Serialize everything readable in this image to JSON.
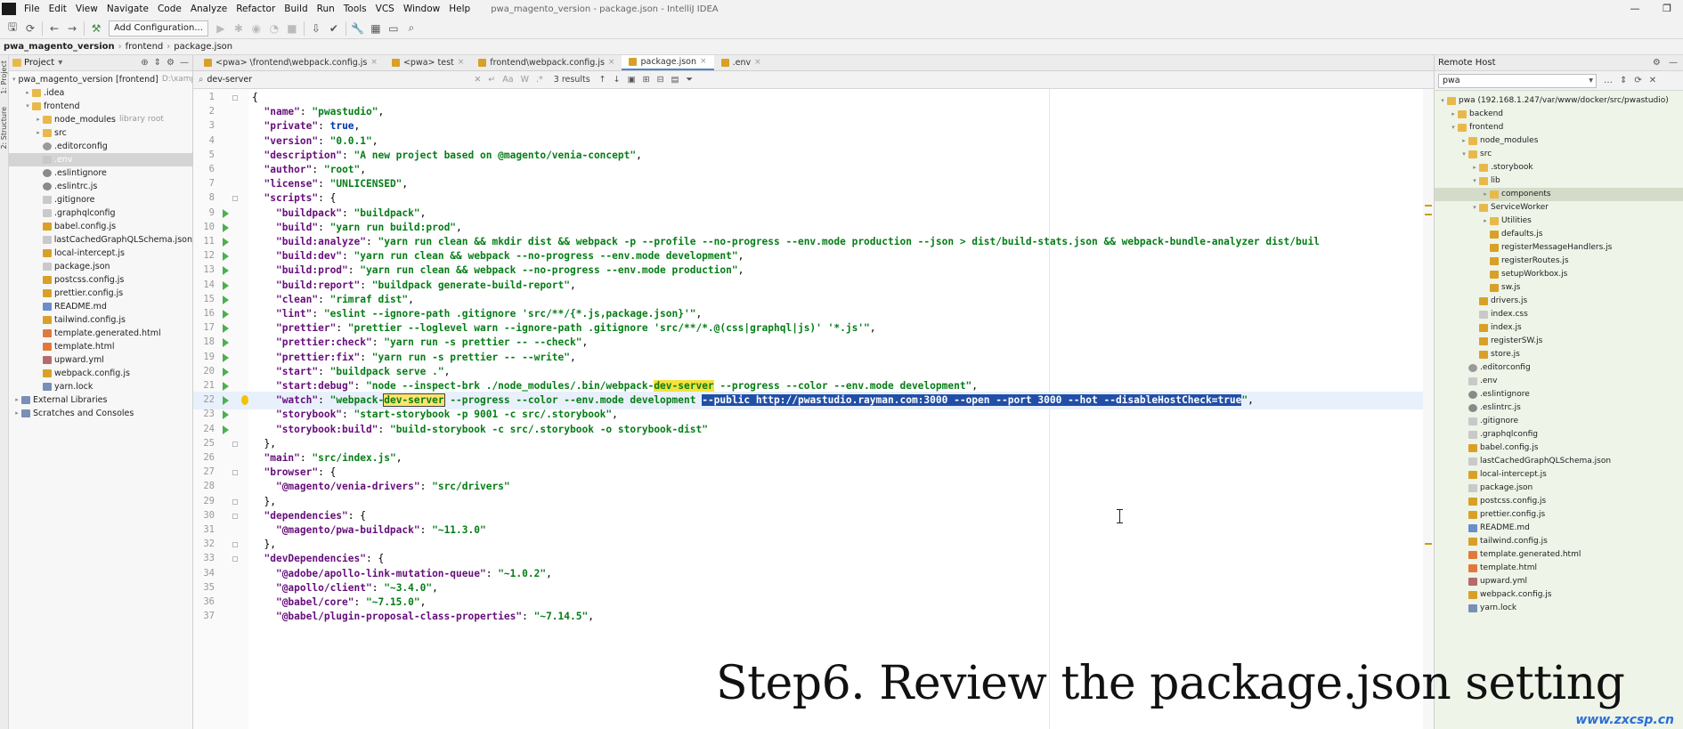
{
  "window": {
    "title": "pwa_magento_version - package.json - IntelliJ IDEA",
    "menu": [
      "File",
      "Edit",
      "View",
      "Navigate",
      "Code",
      "Analyze",
      "Refactor",
      "Build",
      "Run",
      "Tools",
      "VCS",
      "Window",
      "Help"
    ],
    "controls": [
      "—",
      "❐"
    ]
  },
  "toolbar": {
    "add_config": "Add Configuration..."
  },
  "breadcrumb": [
    "pwa_magento_version",
    "frontend",
    "package.json"
  ],
  "project": {
    "title": "Project",
    "strip_label": "1: Project",
    "strip_label2": "2: Structure",
    "tree": [
      {
        "label": "pwa_magento_version [frontend]",
        "extra": "D:\\xampp",
        "indent": 0,
        "arrow": "▾",
        "icon": "fold"
      },
      {
        "label": ".idea",
        "indent": 1,
        "arrow": "▸",
        "icon": "fold"
      },
      {
        "label": "frontend",
        "indent": 1,
        "arrow": "▾",
        "icon": "fold"
      },
      {
        "label": "node_modules",
        "extra": "library root",
        "indent": 2,
        "arrow": "▸",
        "icon": "fold"
      },
      {
        "label": "src",
        "indent": 2,
        "arrow": "▸",
        "icon": "fold"
      },
      {
        "label": ".editorconfig",
        "indent": 2,
        "arrow": "",
        "icon": "gear"
      },
      {
        "label": ".env",
        "indent": 2,
        "arrow": "",
        "icon": "file",
        "selected": true
      },
      {
        "label": ".eslintignore",
        "indent": 2,
        "arrow": "",
        "icon": "cfg"
      },
      {
        "label": ".eslintrc.js",
        "indent": 2,
        "arrow": "",
        "icon": "cfg"
      },
      {
        "label": ".gitignore",
        "indent": 2,
        "arrow": "",
        "icon": "file"
      },
      {
        "label": ".graphqlconfig",
        "indent": 2,
        "arrow": "",
        "icon": "file"
      },
      {
        "label": "babel.config.js",
        "indent": 2,
        "arrow": "",
        "icon": "js"
      },
      {
        "label": "lastCachedGraphQLSchema.json",
        "indent": 2,
        "arrow": "",
        "icon": "file"
      },
      {
        "label": "local-intercept.js",
        "indent": 2,
        "arrow": "",
        "icon": "js"
      },
      {
        "label": "package.json",
        "indent": 2,
        "arrow": "",
        "icon": "file"
      },
      {
        "label": "postcss.config.js",
        "indent": 2,
        "arrow": "",
        "icon": "js"
      },
      {
        "label": "prettier.config.js",
        "indent": 2,
        "arrow": "",
        "icon": "js"
      },
      {
        "label": "README.md",
        "indent": 2,
        "arrow": "",
        "icon": "md"
      },
      {
        "label": "tailwind.config.js",
        "indent": 2,
        "arrow": "",
        "icon": "js"
      },
      {
        "label": "template.generated.html",
        "indent": 2,
        "arrow": "",
        "icon": "html"
      },
      {
        "label": "template.html",
        "indent": 2,
        "arrow": "",
        "icon": "html"
      },
      {
        "label": "upward.yml",
        "indent": 2,
        "arrow": "",
        "icon": "yml"
      },
      {
        "label": "webpack.config.js",
        "indent": 2,
        "arrow": "",
        "icon": "js"
      },
      {
        "label": "yarn.lock",
        "indent": 2,
        "arrow": "",
        "icon": "lib"
      },
      {
        "label": "External Libraries",
        "indent": 0,
        "arrow": "▸",
        "icon": "lib"
      },
      {
        "label": "Scratches and Consoles",
        "indent": 0,
        "arrow": "▸",
        "icon": "lib"
      }
    ]
  },
  "tabs": [
    {
      "label": "<pwa> \\frontend\\webpack.config.js",
      "active": false
    },
    {
      "label": "<pwa> test",
      "active": false
    },
    {
      "label": "frontend\\webpack.config.js",
      "active": false
    },
    {
      "label": "package.json",
      "active": true
    },
    {
      "label": ".env",
      "active": false
    }
  ],
  "search": {
    "query": "dev-server",
    "results": "3 results"
  },
  "editor": {
    "lines": [
      {
        "n": "1",
        "html": "{",
        "fold": true
      },
      {
        "n": "2",
        "html": "  <span class='k'>\"name\"</span>: <span class='s'>\"pwastudio\"</span>,"
      },
      {
        "n": "3",
        "html": "  <span class='k'>\"private\"</span>: <span class='v'>true</span>,"
      },
      {
        "n": "4",
        "html": "  <span class='k'>\"version\"</span>: <span class='s'>\"0.0.1\"</span>,"
      },
      {
        "n": "5",
        "html": "  <span class='k'>\"description\"</span>: <span class='s'>\"A new project based on @magento/venia-concept\"</span>,"
      },
      {
        "n": "6",
        "html": "  <span class='k'>\"author\"</span>: <span class='s'>\"root\"</span>,"
      },
      {
        "n": "7",
        "html": "  <span class='k'>\"license\"</span>: <span class='s'>\"UNLICENSED\"</span>,"
      },
      {
        "n": "8",
        "html": "  <span class='k'>\"scripts\"</span>: {",
        "fold": true
      },
      {
        "n": "9",
        "html": "    <span class='k'>\"buildpack\"</span>: <span class='s'>\"buildpack\"</span>,",
        "run": true
      },
      {
        "n": "10",
        "html": "    <span class='k'>\"build\"</span>: <span class='s'>\"yarn run build:prod\"</span>,",
        "run": true
      },
      {
        "n": "11",
        "html": "    <span class='k'>\"build:analyze\"</span>: <span class='s'>\"yarn run clean &amp;&amp; mkdir dist &amp;&amp; webpack -p --profile --no-progress --env.mode production --json &gt; dist/build-stats.json &amp;&amp; webpack-bundle-analyzer dist/buil</span>",
        "run": true
      },
      {
        "n": "12",
        "html": "    <span class='k'>\"build:dev\"</span>: <span class='s'>\"yarn run clean &amp;&amp; webpack --no-progress --env.mode development\"</span>,",
        "run": true
      },
      {
        "n": "13",
        "html": "    <span class='k'>\"build:prod\"</span>: <span class='s'>\"yarn run clean &amp;&amp; webpack --no-progress --env.mode production\"</span>,",
        "run": true
      },
      {
        "n": "14",
        "html": "    <span class='k'>\"build:report\"</span>: <span class='s'>\"buildpack generate-build-report\"</span>,",
        "run": true
      },
      {
        "n": "15",
        "html": "    <span class='k'>\"clean\"</span>: <span class='s'>\"rimraf dist\"</span>,",
        "run": true
      },
      {
        "n": "16",
        "html": "    <span class='k'>\"lint\"</span>: <span class='s'>\"eslint --ignore-path .gitignore 'src/**/{*.js,package.json}'\"</span>,",
        "run": true
      },
      {
        "n": "17",
        "html": "    <span class='k'>\"prettier\"</span>: <span class='s'>\"prettier --loglevel warn --ignore-path .gitignore 'src/**/*.@(css|graphql|js)' '*.js'\"</span>,",
        "run": true
      },
      {
        "n": "18",
        "html": "    <span class='k'>\"prettier:check\"</span>: <span class='s'>\"yarn run -s prettier -- --check\"</span>,",
        "run": true
      },
      {
        "n": "19",
        "html": "    <span class='k'>\"prettier:fix\"</span>: <span class='s'>\"yarn run -s prettier -- --write\"</span>,",
        "run": true
      },
      {
        "n": "20",
        "html": "    <span class='k'>\"start\"</span>: <span class='s'>\"buildpack serve .\"</span>,",
        "run": true
      },
      {
        "n": "21",
        "html": "    <span class='k'>\"start:debug\"</span>: <span class='s'>\"node --inspect-brk ./node_modules/.bin/webpack-<span class='hl'>dev-server</span> --progress --color --env.mode development\"</span>,",
        "run": true
      },
      {
        "n": "22",
        "html": "    <span class='k'>\"watch\"</span>: <span class='s'>\"webpack-<span class='hlb'>dev-server</span> --progress --color --env.mode development <span class='sel'>--public http://pwastudio.rayman.com:3000 --open --port 3000 --hot --disableHostCheck=true</span>\"</span>,",
        "run": true,
        "bulb": true,
        "current": true
      },
      {
        "n": "23",
        "html": "    <span class='k'>\"storybook\"</span>: <span class='s'>\"start-storybook -p 9001 -c src/.storybook\"</span>,",
        "run": true
      },
      {
        "n": "24",
        "html": "    <span class='k'>\"storybook:build\"</span>: <span class='s'>\"build-storybook -c src/.storybook -o storybook-dist\"</span>",
        "run": true
      },
      {
        "n": "25",
        "html": "  },",
        "fold": true
      },
      {
        "n": "26",
        "html": "  <span class='k'>\"main\"</span>: <span class='s'>\"src/index.js\"</span>,"
      },
      {
        "n": "27",
        "html": "  <span class='k'>\"browser\"</span>: {",
        "fold": true
      },
      {
        "n": "28",
        "html": "    <span class='k'>\"@magento/venia-drivers\"</span>: <span class='s'>\"src/drivers\"</span>"
      },
      {
        "n": "29",
        "html": "  },",
        "fold": true
      },
      {
        "n": "30",
        "html": "  <span class='k'>\"dependencies\"</span>: {",
        "fold": true
      },
      {
        "n": "31",
        "html": "    <span class='k'>\"@magento/pwa-buildpack\"</span>: <span class='s'>\"~11.3.0\"</span>"
      },
      {
        "n": "32",
        "html": "  },",
        "fold": true
      },
      {
        "n": "33",
        "html": "  <span class='k'>\"devDependencies\"</span>: {",
        "fold": true
      },
      {
        "n": "34",
        "html": "    <span class='k'>\"@adobe/apollo-link-mutation-queue\"</span>: <span class='s'>\"~1.0.2\"</span>,"
      },
      {
        "n": "35",
        "html": "    <span class='k'>\"@apollo/client\"</span>: <span class='s'>\"~3.4.0\"</span>,"
      },
      {
        "n": "36",
        "html": "    <span class='k'>\"@babel/core\"</span>: <span class='s'>\"~7.15.0\"</span>,"
      },
      {
        "n": "37",
        "html": "    <span class='k'>\"@babel/plugin-proposal-class-properties\"</span>: <span class='s'>\"~7.14.5\"</span>,"
      }
    ]
  },
  "remote": {
    "title": "Remote Host",
    "server": "pwa",
    "tree": [
      {
        "label": "pwa (192.168.1.247/var/www/docker/src/pwastudio)",
        "indent": 0,
        "arrow": "▾",
        "icon": "fold"
      },
      {
        "label": "backend",
        "indent": 1,
        "arrow": "▸",
        "icon": "fold"
      },
      {
        "label": "frontend",
        "indent": 1,
        "arrow": "▾",
        "icon": "fold"
      },
      {
        "label": "node_modules",
        "indent": 2,
        "arrow": "▸",
        "icon": "fold"
      },
      {
        "label": "src",
        "indent": 2,
        "arrow": "▾",
        "icon": "fold"
      },
      {
        "label": ".storybook",
        "indent": 3,
        "arrow": "▸",
        "icon": "fold"
      },
      {
        "label": "lib",
        "indent": 3,
        "arrow": "▾",
        "icon": "fold"
      },
      {
        "label": "components",
        "indent": 4,
        "arrow": "▸",
        "icon": "fold",
        "hi": true
      },
      {
        "label": "ServiceWorker",
        "indent": 3,
        "arrow": "▾",
        "icon": "fold"
      },
      {
        "label": "Utilities",
        "indent": 4,
        "arrow": "▸",
        "icon": "fold"
      },
      {
        "label": "defaults.js",
        "indent": 4,
        "arrow": "",
        "icon": "js"
      },
      {
        "label": "registerMessageHandlers.js",
        "indent": 4,
        "arrow": "",
        "icon": "js"
      },
      {
        "label": "registerRoutes.js",
        "indent": 4,
        "arrow": "",
        "icon": "js"
      },
      {
        "label": "setupWorkbox.js",
        "indent": 4,
        "arrow": "",
        "icon": "js"
      },
      {
        "label": "sw.js",
        "indent": 4,
        "arrow": "",
        "icon": "js"
      },
      {
        "label": "drivers.js",
        "indent": 3,
        "arrow": "",
        "icon": "js"
      },
      {
        "label": "index.css",
        "indent": 3,
        "arrow": "",
        "icon": "file"
      },
      {
        "label": "index.js",
        "indent": 3,
        "arrow": "",
        "icon": "js"
      },
      {
        "label": "registerSW.js",
        "indent": 3,
        "arrow": "",
        "icon": "js"
      },
      {
        "label": "store.js",
        "indent": 3,
        "arrow": "",
        "icon": "js"
      },
      {
        "label": ".editorconfig",
        "indent": 2,
        "arrow": "",
        "icon": "gear"
      },
      {
        "label": ".env",
        "indent": 2,
        "arrow": "",
        "icon": "file"
      },
      {
        "label": ".eslintignore",
        "indent": 2,
        "arrow": "",
        "icon": "cfg"
      },
      {
        "label": ".eslintrc.js",
        "indent": 2,
        "arrow": "",
        "icon": "cfg"
      },
      {
        "label": ".gitignore",
        "indent": 2,
        "arrow": "",
        "icon": "file"
      },
      {
        "label": ".graphqlconfig",
        "indent": 2,
        "arrow": "",
        "icon": "file"
      },
      {
        "label": "babel.config.js",
        "indent": 2,
        "arrow": "",
        "icon": "js"
      },
      {
        "label": "lastCachedGraphQLSchema.json",
        "indent": 2,
        "arrow": "",
        "icon": "file"
      },
      {
        "label": "local-intercept.js",
        "indent": 2,
        "arrow": "",
        "icon": "js"
      },
      {
        "label": "package.json",
        "indent": 2,
        "arrow": "",
        "icon": "file"
      },
      {
        "label": "postcss.config.js",
        "indent": 2,
        "arrow": "",
        "icon": "js"
      },
      {
        "label": "prettier.config.js",
        "indent": 2,
        "arrow": "",
        "icon": "js"
      },
      {
        "label": "README.md",
        "indent": 2,
        "arrow": "",
        "icon": "md"
      },
      {
        "label": "tailwind.config.js",
        "indent": 2,
        "arrow": "",
        "icon": "js"
      },
      {
        "label": "template.generated.html",
        "indent": 2,
        "arrow": "",
        "icon": "html"
      },
      {
        "label": "template.html",
        "indent": 2,
        "arrow": "",
        "icon": "html"
      },
      {
        "label": "upward.yml",
        "indent": 2,
        "arrow": "",
        "icon": "yml"
      },
      {
        "label": "webpack.config.js",
        "indent": 2,
        "arrow": "",
        "icon": "js"
      },
      {
        "label": "yarn.lock",
        "indent": 2,
        "arrow": "",
        "icon": "lib"
      }
    ]
  },
  "overlay": {
    "caption": "Step6. Review the package.json setting",
    "watermark": "www.zxcsp.cn"
  }
}
